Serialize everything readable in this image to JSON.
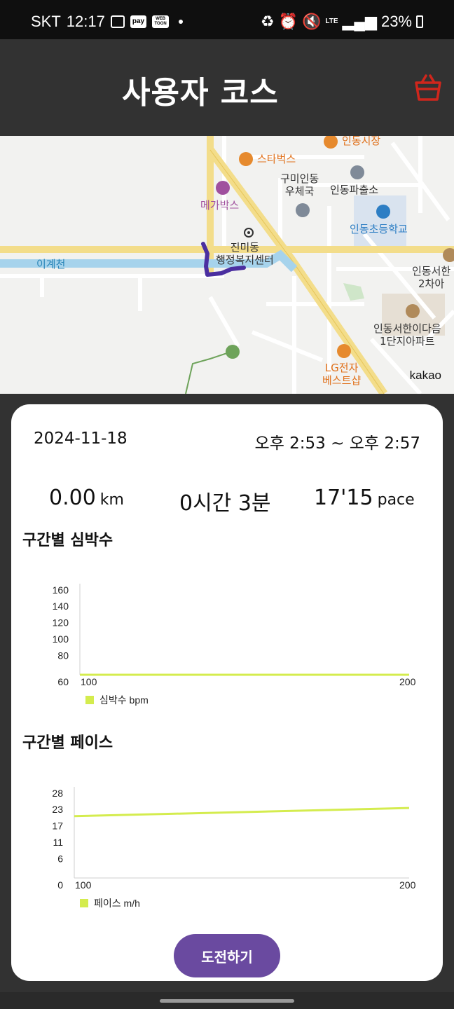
{
  "status_bar": {
    "carrier": "SKT",
    "time": "12:17",
    "pay_label": "pay",
    "webtoon_label": "WEB TOON",
    "network": "LTE",
    "battery": "23%"
  },
  "header": {
    "title": "사용자 코스",
    "basket_icon": "basket-icon",
    "accent": "#d0261c"
  },
  "map": {
    "labels": {
      "starbucks": "스타벅스",
      "market": "인동시장",
      "post_office": "구미인동\n우체국",
      "police": "인동파출소",
      "megabox": "메가박스",
      "school": "인동초등학교",
      "community_center": "진미동\n행정복지센터",
      "stream": "이계천",
      "apt2": "인동서한\n2차아",
      "apt1": "인동서한이다음\n1단지아파트",
      "lg": "LG전자\n베스트샵"
    },
    "attribution": "kakao",
    "route_color": "#4b2fa0"
  },
  "session": {
    "date": "2024-11-18",
    "time_range": "오후 2:53 ~ 오후 2:57"
  },
  "stats": {
    "distance_value": "0.00",
    "distance_unit": "km",
    "duration": "0시간 3분",
    "pace_value": "17'15",
    "pace_unit": "pace"
  },
  "heart_section": {
    "title": "구간별 심박수"
  },
  "pace_section": {
    "title": "구간별 페이스"
  },
  "chart_data": [
    {
      "type": "line",
      "x": [
        100,
        200
      ],
      "series": [
        {
          "name": "심박수 bpm",
          "values": [
            60,
            60
          ],
          "color": "#d4ec4e"
        }
      ],
      "y_ticks": [
        "60",
        "80",
        "100",
        "120",
        "140",
        "160"
      ],
      "x_ticks": [
        "100",
        "200"
      ],
      "ylim": [
        60,
        160
      ],
      "xlim": [
        100,
        200
      ],
      "legend": "bottom-left"
    },
    {
      "type": "line",
      "x": [
        100,
        200
      ],
      "series": [
        {
          "name": "페이스 m/h",
          "values": [
            19,
            21.5
          ],
          "color": "#d4ec4e"
        }
      ],
      "y_ticks": [
        "0",
        "6",
        "11",
        "17",
        "23",
        "28"
      ],
      "x_ticks": [
        "100",
        "200"
      ],
      "ylim": [
        0,
        28
      ],
      "xlim": [
        100,
        200
      ],
      "legend": "bottom-left"
    }
  ],
  "button": {
    "label": "도전하기",
    "color": "#6a4aa0"
  }
}
